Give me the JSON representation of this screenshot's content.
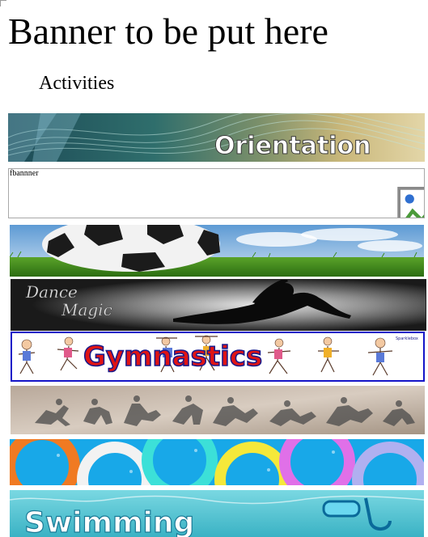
{
  "page": {
    "title": "Banner to be put here",
    "section_heading": "Activities"
  },
  "banners": [
    {
      "id": "orientation",
      "text": "Orientation"
    },
    {
      "id": "fb",
      "alt_text": "fbannner"
    },
    {
      "id": "football"
    },
    {
      "id": "dance",
      "text_line1": "Dance",
      "text_line2": "Magic"
    },
    {
      "id": "gymnastics",
      "text": "Gymnastics",
      "tag": "Sparklebox"
    },
    {
      "id": "silhouettes"
    },
    {
      "id": "rings"
    },
    {
      "id": "swimming",
      "text": "Swimming"
    }
  ],
  "colors": {
    "gym_border": "#1414c8",
    "gym_text": "#e01414",
    "rings_bg": "#18a8e8",
    "swim_bg": "#56c8d6"
  }
}
